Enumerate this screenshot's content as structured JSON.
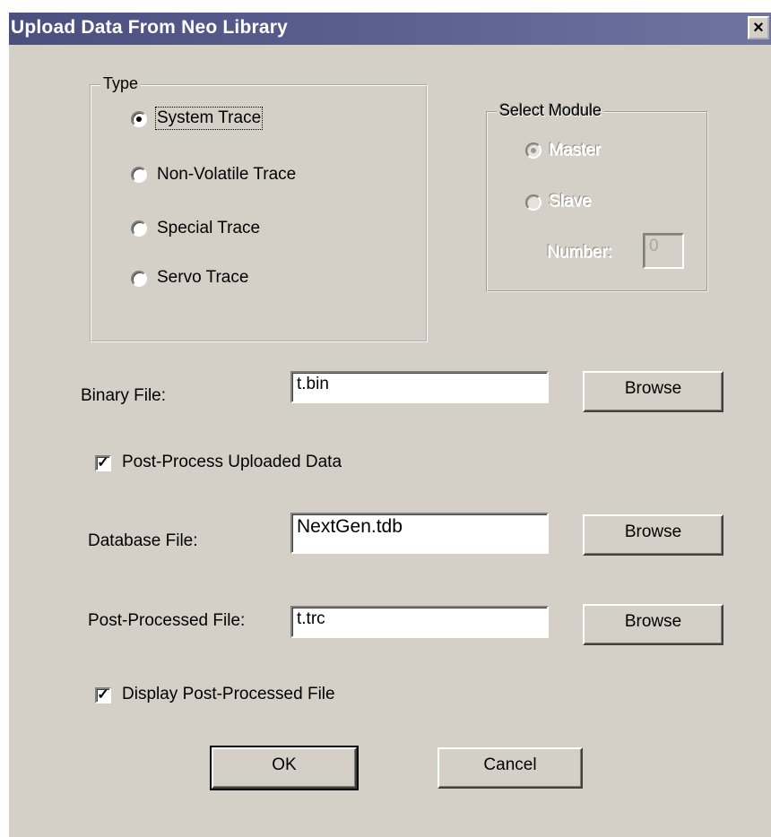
{
  "window": {
    "title": "Upload Data From Neo Library",
    "close_label": "×"
  },
  "type_group": {
    "legend": "Type",
    "options": [
      {
        "label": "System Trace",
        "selected": true
      },
      {
        "label": "Non-Volatile Trace",
        "selected": false
      },
      {
        "label": "Special Trace",
        "selected": false
      },
      {
        "label": "Servo Trace",
        "selected": false
      }
    ]
  },
  "module_group": {
    "legend": "Select Module",
    "enabled": false,
    "options": [
      {
        "label": "Master",
        "selected": true
      },
      {
        "label": "Slave",
        "selected": false
      }
    ],
    "number_label": "Number:",
    "number_value": "0"
  },
  "binary_file": {
    "label": "Binary File:",
    "value": "t.bin",
    "browse_label": "Browse"
  },
  "post_process": {
    "label": "Post-Process Uploaded Data",
    "checked": true,
    "check_mark": "✓"
  },
  "database_file": {
    "label": "Database File:",
    "value": "NextGen.tdb",
    "browse_label": "Browse"
  },
  "post_processed_file": {
    "label": "Post-Processed File:",
    "value": "t.trc",
    "browse_label": "Browse"
  },
  "display_file": {
    "label": "Display Post-Processed File",
    "checked": true,
    "check_mark": "✓"
  },
  "buttons": {
    "ok": "OK",
    "cancel": "Cancel"
  }
}
